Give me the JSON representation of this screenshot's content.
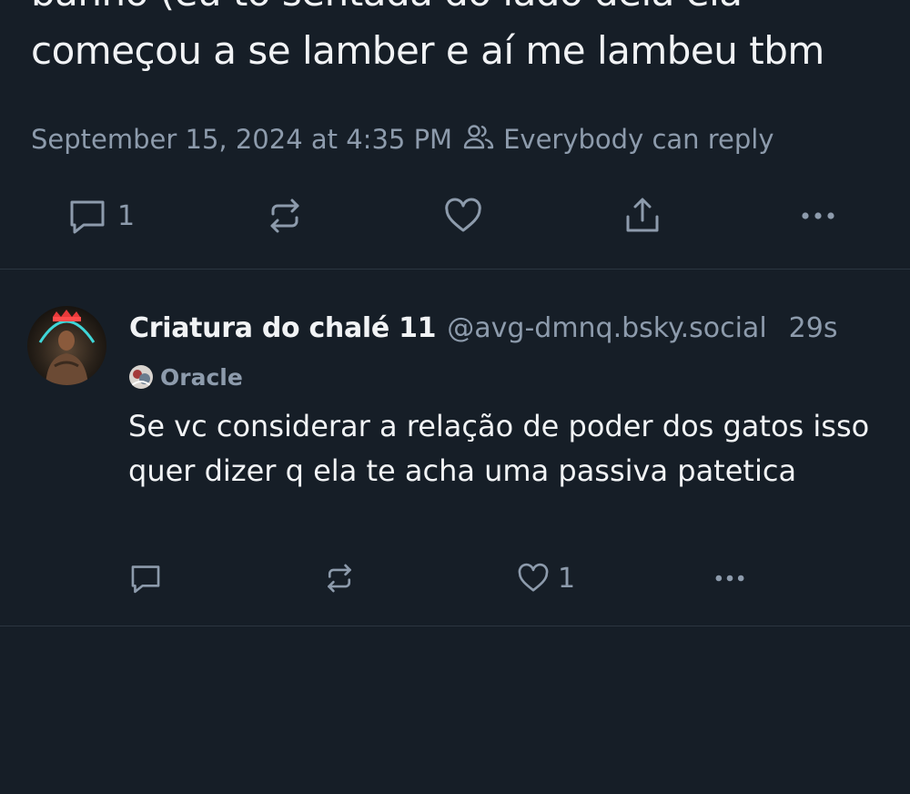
{
  "post": {
    "text_line1": "banho (eu tô sentada do lado dela ela",
    "text_line2": "começou a se lamber e aí me lambeu tbm",
    "timestamp": "September 15, 2024 at 4:35 PM",
    "reply_setting": "Everybody can reply",
    "reply_count": "1"
  },
  "reply": {
    "display_name": "Criatura do chalé 11",
    "handle": "@avg-dmnq.bsky.social",
    "time_ago": "29s",
    "label": "Oracle",
    "text": "Se vc considerar a relação de poder dos gatos isso quer dizer q ela te acha uma passiva patetica",
    "like_count": "1"
  },
  "icons": {
    "reply": "speech-bubble-icon",
    "repost": "repost-arrows-icon",
    "like": "heart-icon",
    "share": "share-upload-icon",
    "more": "more-dots-icon",
    "audience": "people-icon"
  },
  "colors": {
    "background": "#161e27",
    "text": "#f1f3f5",
    "muted": "#8d9bac",
    "divider": "#2b3641"
  }
}
